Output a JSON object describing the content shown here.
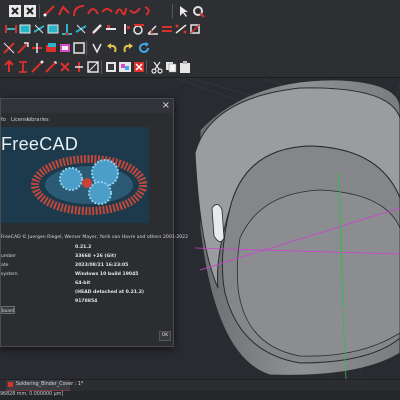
{
  "app": {
    "title": "FreeCAD"
  },
  "about_dialog": {
    "close_glyph": "×",
    "tabs": [
      "fo",
      "License",
      "Libraries"
    ],
    "banner_title": "FreeCAD",
    "copyright": "FreeCAD © Juergen Riegel, Werner Mayer, Yorik van Havre and others 2001-2022",
    "info_rows": [
      {
        "label": "",
        "value": "0.21.2"
      },
      {
        "label": "umber",
        "value": "33668 +26 (Git)"
      },
      {
        "label": "ate",
        "value": "2023/08/21 16:23:05"
      },
      {
        "label": "system",
        "value": "Windows 10 build 19045"
      },
      {
        "label": "",
        "value": "64-bit"
      },
      {
        "label": "",
        "value": "(HEAD detached at 0.21.2)"
      },
      {
        "label": "",
        "value": "9178854"
      }
    ],
    "clipboard_label": "board",
    "ok_label": "OK"
  },
  "document_tab": {
    "label": "Soldering_Binder_Cover : 1*"
  },
  "status_bar": {
    "text": "96828 mm, 0.000000 µm]"
  },
  "colors": {
    "accent_red": "#d9302d",
    "accent_cyan": "#26b6c8",
    "axis_green": "#2fbf47",
    "axis_magenta": "#cf3fd2",
    "model_face": "#8e9093"
  }
}
